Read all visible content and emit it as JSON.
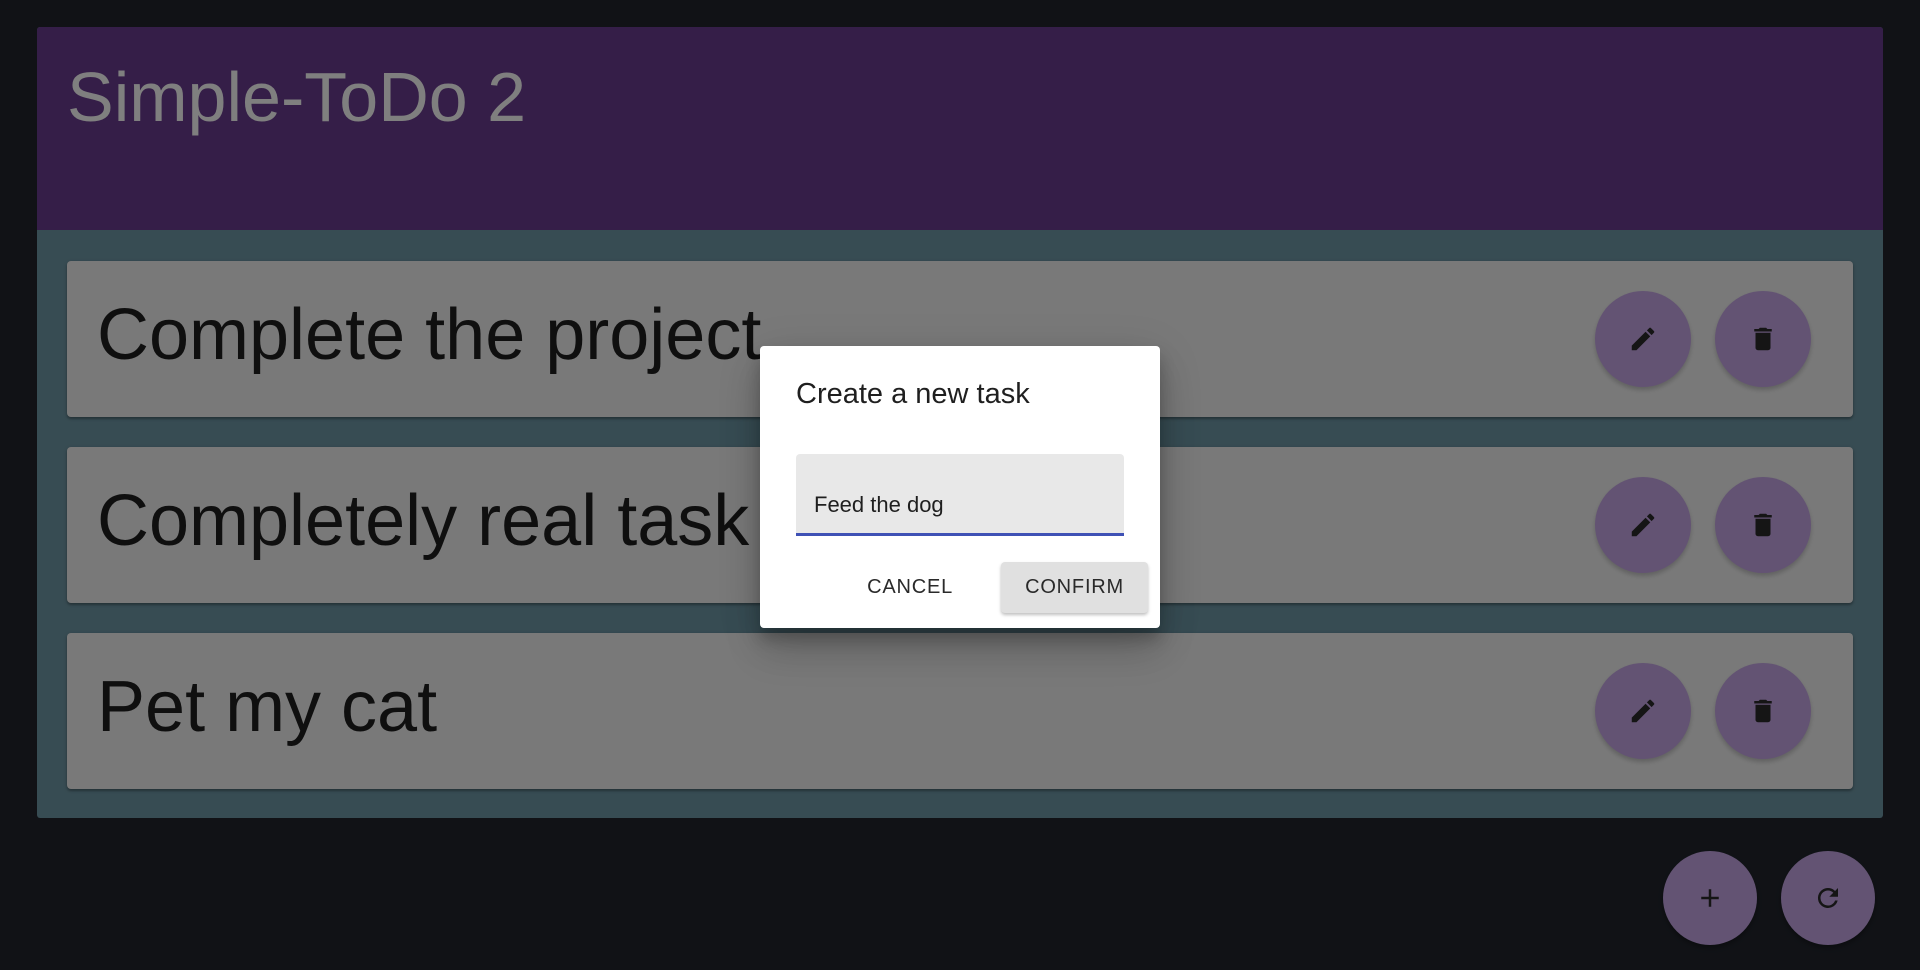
{
  "app": {
    "title": "Simple-ToDo 2"
  },
  "tasks": [
    {
      "text": "Complete the project",
      "edit_icon": "pencil-icon",
      "delete_icon": "trash-icon"
    },
    {
      "text": "Completely real task",
      "edit_icon": "pencil-icon",
      "delete_icon": "trash-icon"
    },
    {
      "text": "Pet my cat",
      "edit_icon": "pencil-icon",
      "delete_icon": "trash-icon"
    }
  ],
  "fabs": {
    "add_icon": "plus-icon",
    "refresh_icon": "refresh-icon"
  },
  "dialog": {
    "title": "Create a new task",
    "input_value": "Feed the dog",
    "cancel_label": "CANCEL",
    "confirm_label": "CONFIRM"
  },
  "colors": {
    "header": "#6b3d91",
    "body": "#6f98a6",
    "page_background": "#22252d",
    "action_button": "#c6a6e6",
    "input_underline": "#3f51b5"
  }
}
